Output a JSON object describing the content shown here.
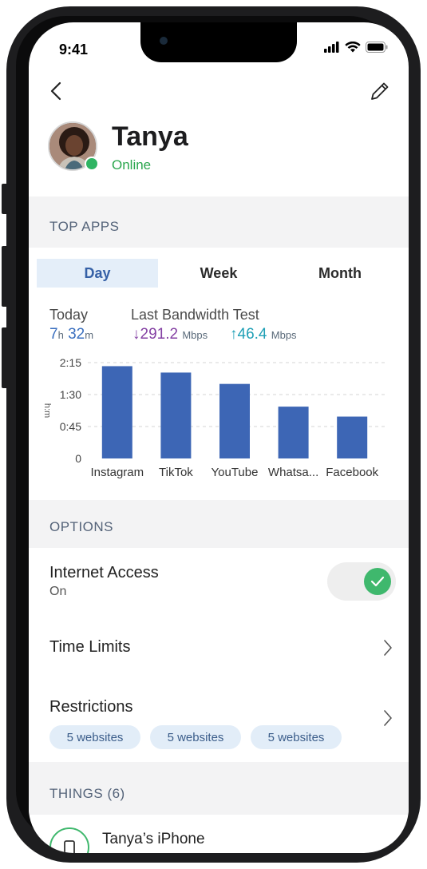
{
  "status_bar": {
    "time": "9:41"
  },
  "profile": {
    "name": "Tanya",
    "status": "Online"
  },
  "top_apps": {
    "section_title": "TOP APPS",
    "tabs": [
      {
        "label": "Day",
        "active": true
      },
      {
        "label": "Week",
        "active": false
      },
      {
        "label": "Month",
        "active": false
      }
    ],
    "today_label": "Today",
    "today_hours": "7",
    "today_hours_unit": "h",
    "today_minutes": "32",
    "today_minutes_unit": "m",
    "bandwidth_label": "Last Bandwidth Test",
    "download_arrow": "↓",
    "download_value": "291.2",
    "upload_arrow": "↑",
    "upload_value": "46.4",
    "bandwidth_unit": "Mbps"
  },
  "chart_data": {
    "type": "bar",
    "ylabel": "h:m",
    "y_ticks": [
      "0",
      "0:45",
      "1:30",
      "2:15"
    ],
    "y_tick_values": [
      0,
      45,
      90,
      135
    ],
    "ylim": [
      0,
      135
    ],
    "categories": [
      "Instagram",
      "TikTok",
      "YouTube",
      "Whatsa...",
      "Facebook"
    ],
    "values": [
      130,
      121,
      105,
      73,
      59
    ],
    "bar_color": "#3d66b5",
    "grid": true
  },
  "options": {
    "section_title": "OPTIONS",
    "internet_access": {
      "title": "Internet Access",
      "value": "On",
      "enabled": true
    },
    "time_limits": {
      "title": "Time Limits"
    },
    "restrictions": {
      "title": "Restrictions",
      "chips": [
        "5 websites",
        "5 websites",
        "5 websites"
      ]
    }
  },
  "things": {
    "section_title": "THINGS (6)",
    "items": [
      {
        "name": "Tanya’s iPhone"
      }
    ]
  },
  "colors": {
    "accent": "#3560a6",
    "online": "#2aa64d",
    "toggle_on": "#3fb86d",
    "bar": "#3d66b5"
  }
}
